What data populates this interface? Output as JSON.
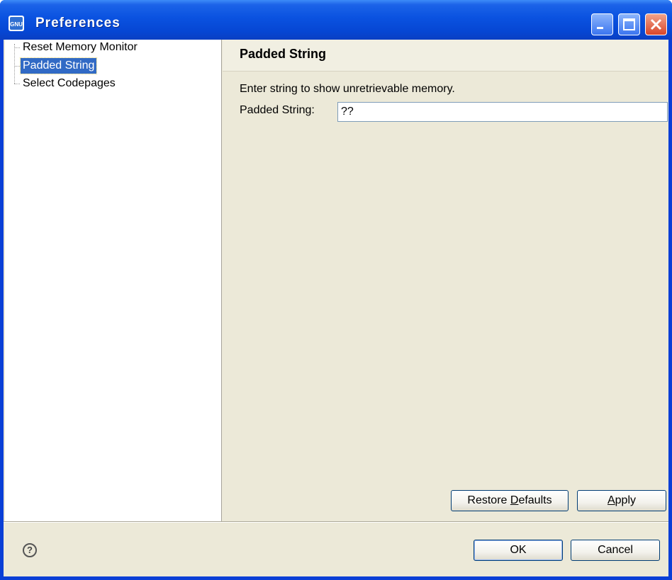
{
  "window": {
    "title": "Preferences",
    "icon": "gnu-app-icon",
    "controls": [
      "minimize-icon",
      "maximize-icon",
      "close-icon"
    ]
  },
  "tree": {
    "items": [
      {
        "label": "Reset Memory Monitor",
        "selected": false
      },
      {
        "label": "Padded String",
        "selected": true
      },
      {
        "label": "Select Codepages",
        "selected": false
      }
    ]
  },
  "page": {
    "title": "Padded String",
    "description": "Enter string to show unretrievable memory.",
    "field_label": "Padded String:",
    "field_value": "??"
  },
  "buttons": {
    "restore_defaults_pre": "Restore ",
    "restore_defaults_mnemonic": "D",
    "restore_defaults_post": "efaults",
    "apply_mnemonic": "A",
    "apply_post": "pply",
    "ok": "OK",
    "cancel": "Cancel"
  },
  "help_icon": "help-icon"
}
